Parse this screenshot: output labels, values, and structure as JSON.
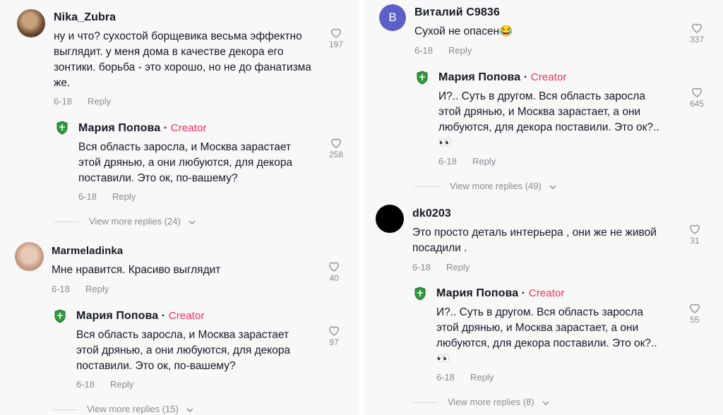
{
  "left": {
    "c1": {
      "username": "Nika_Zubra",
      "text": "ну и что? сухостой борщевика весьма эффектно выглядит. у меня дома в качестве декора его зонтики. борьба - это хорошо, но не до фанатизма же.",
      "date": "6-18",
      "reply": "Reply",
      "likes": "197",
      "reply1": {
        "username": "Мария Попова",
        "dot": " · ",
        "creator": "Creator",
        "text": "Вся область заросла, и Москва зарастает этой дрянью, а они любуются, для декора поставили. Это ок, по-вашему?",
        "date": "6-18",
        "reply": "Reply",
        "likes": "258"
      },
      "more": "View more replies (24)"
    },
    "c2": {
      "username": "Marmeladinka",
      "text": "Мне нравится. Красиво выглядит",
      "date": "6-18",
      "reply": "Reply",
      "likes": "40",
      "reply1": {
        "username": "Мария Попова",
        "dot": " · ",
        "creator": "Creator",
        "text": "Вся область заросла, и Москва зарастает этой дрянью, а они любуются, для декора поставили. Это ок, по-вашему?",
        "date": "6-18",
        "reply": "Reply",
        "likes": "97"
      },
      "more": "View more replies (15)"
    }
  },
  "right": {
    "c1": {
      "avatar_letter": "B",
      "username": "Виталий С9836",
      "text": "Сухой не опасен😂",
      "date": "6-18",
      "reply": "Reply",
      "likes": "337",
      "reply1": {
        "username": "Мария Попова",
        "dot": " · ",
        "creator": "Creator",
        "text": "И?.. Суть в другом. Вся область заросла этой дрянью, и Москва зарастает, а они любуются, для декора поставили. Это ок?.. 👀",
        "date": "6-18",
        "reply": "Reply",
        "likes": "645"
      },
      "more": "View more replies (49)"
    },
    "c2": {
      "username": "dk0203",
      "text": "Это просто деталь интерьера , они же не живой посадили .",
      "date": "6-18",
      "reply": "Reply",
      "likes": "31",
      "reply1": {
        "username": "Мария Попова",
        "dot": " · ",
        "creator": "Creator",
        "text": "И?.. Суть в другом. Вся область заросла этой дрянью, и Москва зарастает, а они любуются, для декора поставили. Это ок?.. 👀",
        "date": "6-18",
        "reply": "Reply",
        "likes": "55"
      },
      "more": "View more replies (8)"
    }
  },
  "colors": {
    "creator": "#fe2c55",
    "muted": "#8a8b91",
    "avatar_b": "#5b5fc7",
    "shield": "#2e9a3d"
  },
  "icons": {
    "like": "heart-outline-icon",
    "expand": "chevron-down-icon",
    "creator_avatar": "shield-logo-icon"
  }
}
